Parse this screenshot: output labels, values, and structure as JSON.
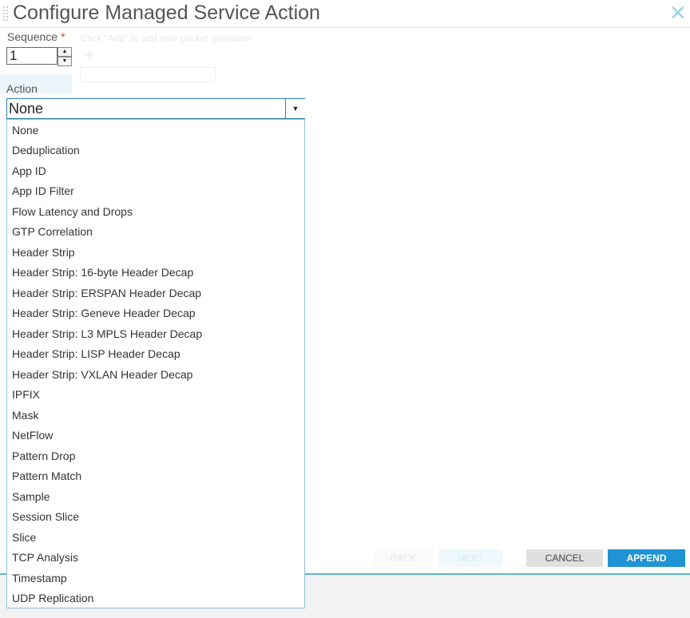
{
  "dialog": {
    "title": "Configure Managed Service Action",
    "close_icon": "close-icon"
  },
  "form": {
    "sequence_label": "Sequence",
    "required_marker": "*",
    "sequence_value": "1",
    "action_label": "Action",
    "action_selected": "None"
  },
  "background": {
    "ghost_text": "Click \"Add\" to add new packet operation"
  },
  "dropdown": {
    "options": [
      "None",
      "Deduplication",
      "App ID",
      "App ID Filter",
      "Flow Latency and Drops",
      "GTP Correlation",
      "Header Strip",
      "Header Strip: 16-byte Header Decap",
      "Header Strip: ERSPAN Header Decap",
      "Header Strip: Geneve Header Decap",
      "Header Strip: L3 MPLS Header Decap",
      "Header Strip: LISP Header Decap",
      "Header Strip: VXLAN Header Decap",
      "IPFIX",
      "Mask",
      "NetFlow",
      "Pattern Drop",
      "Pattern Match",
      "Sample",
      "Session Slice",
      "Slice",
      "TCP Analysis",
      "Timestamp",
      "UDP Replication"
    ]
  },
  "footer": {
    "back_label": "BACK",
    "next_label": "NEXT",
    "cancel_label": "CANCEL",
    "append_label": "APPEND"
  },
  "colors": {
    "accent": "#1f93d3",
    "border_focus": "#2a7fa8",
    "required": "#e0362b"
  }
}
